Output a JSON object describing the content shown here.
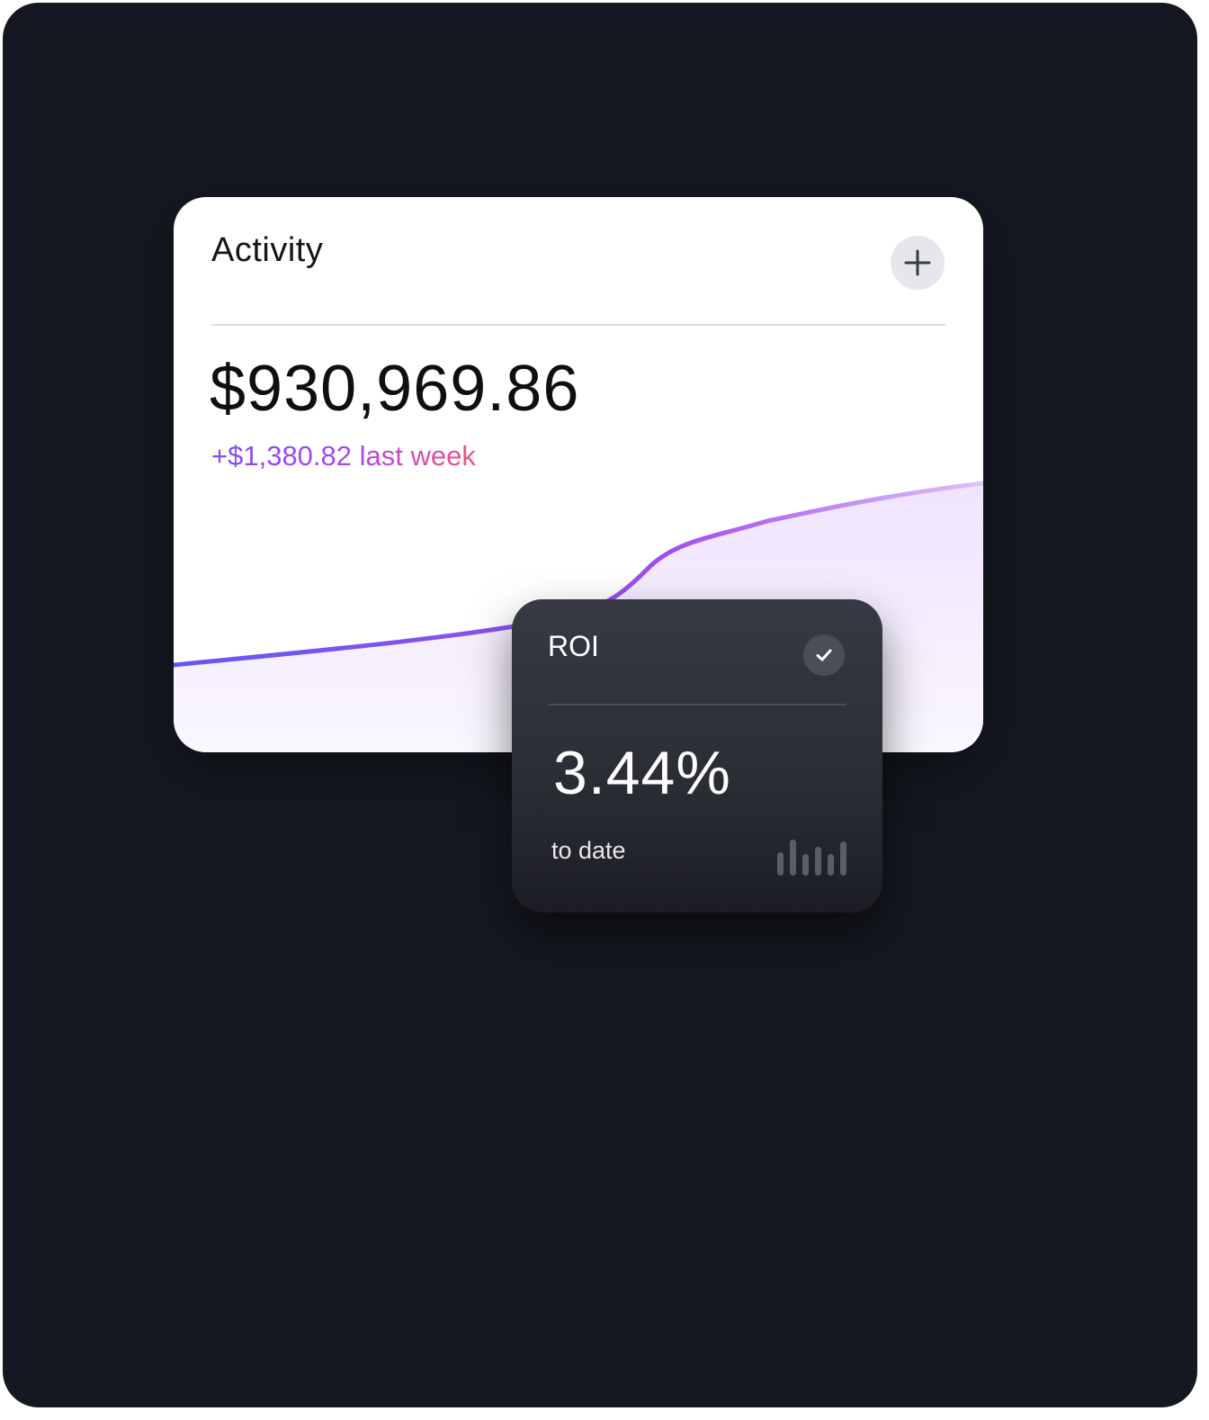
{
  "activity": {
    "title": "Activity",
    "amount": "$930,969.86",
    "change": "+$1,380.82 last week"
  },
  "roi": {
    "title": "ROI",
    "value": "3.44%",
    "subtitle": "to date"
  },
  "icons": {
    "add": "plus-icon",
    "status": "check-icon",
    "sparkline": "bar-chart-icon"
  },
  "colors": {
    "background": "#151820",
    "line_start": "#6457f0",
    "line_mid": "#a24df0",
    "line_end": "#dcc2fb",
    "change_text_start": "#7c4dff",
    "change_text_end": "#f2527a"
  }
}
